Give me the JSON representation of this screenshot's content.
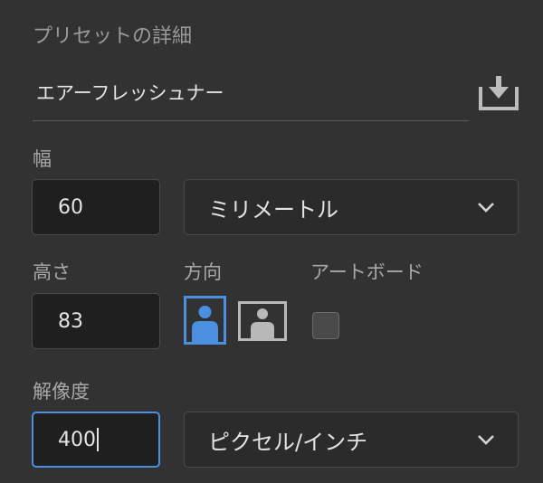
{
  "panel": {
    "title": "プリセットの詳細",
    "preset_name": "エアーフレッシュナー",
    "save_icon": "save-preset-icon"
  },
  "width": {
    "label": "幅",
    "value": "60",
    "unit": "ミリメートル"
  },
  "height": {
    "label": "高さ",
    "value": "83"
  },
  "orientation": {
    "label": "方向",
    "options": [
      "portrait",
      "landscape"
    ],
    "selected": "portrait"
  },
  "artboard": {
    "label": "アートボード",
    "checked": false
  },
  "resolution": {
    "label": "解像度",
    "value": "400",
    "unit": "ピクセル/インチ"
  },
  "colors": {
    "background": "#323232",
    "field_bg": "#1f1f1f",
    "accent": "#4a8fe0",
    "text": "#e4e4e4",
    "label": "#a8a8a8"
  }
}
